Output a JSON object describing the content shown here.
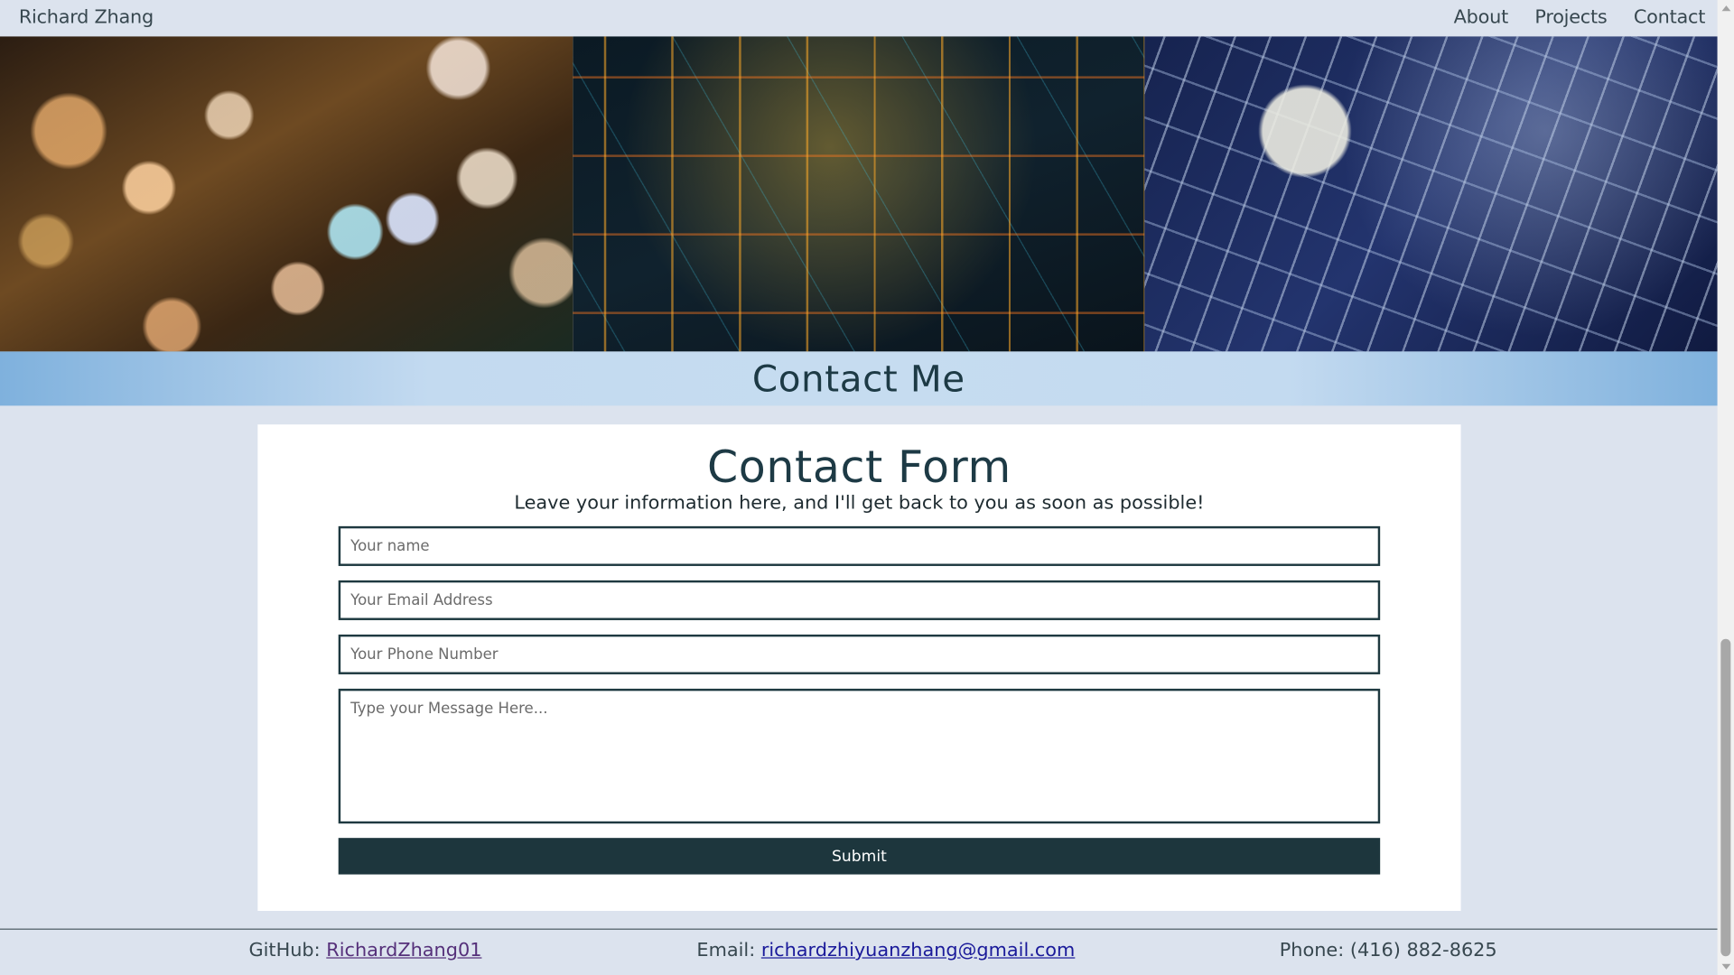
{
  "nav": {
    "brand": "Richard Zhang",
    "links": [
      "About",
      "Projects",
      "Contact"
    ]
  },
  "hero": {
    "images": [
      "city-lights-bokeh-image",
      "glowing-circuit-image",
      "circuit-board-image"
    ]
  },
  "banner": {
    "title": "Contact Me"
  },
  "form": {
    "title": "Contact Form",
    "subtitle": "Leave your information here, and I'll get back to you as soon as possible!",
    "name_placeholder": "Your name",
    "email_placeholder": "Your Email Address",
    "phone_placeholder": "Your Phone Number",
    "message_placeholder": "Type your Message Here...",
    "submit_label": "Submit"
  },
  "footer": {
    "github_label": "GitHub: ",
    "github_link": "RichardZhang01",
    "email_label": "Email: ",
    "email_link": "richardzhiyuanzhang@gmail.com",
    "phone_text": "Phone: (416) 882-8625"
  },
  "colors": {
    "page_background": "#dce3ee",
    "primary_dark": "#1d363d",
    "banner_blue": "#7fb1dd",
    "link_blue": "#1a1a9a"
  }
}
